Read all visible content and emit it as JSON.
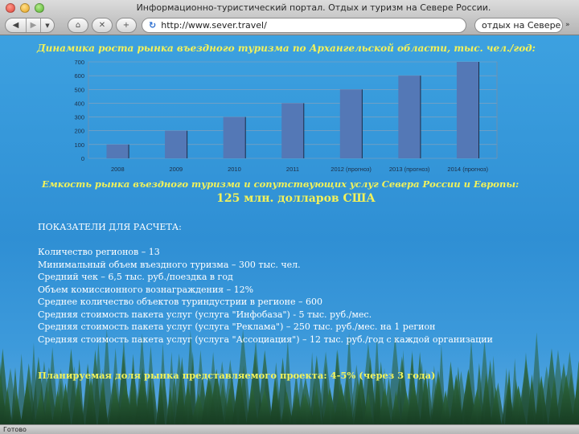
{
  "window": {
    "title": "Информационно-туристический портал. Отдых и туризм на Севере России."
  },
  "toolbar": {
    "url": "http://www.sever.travel/",
    "search_value": "отдых на Севере",
    "icons": [
      "back-icon",
      "forward-icon",
      "home-icon",
      "stop-icon",
      "add-icon",
      "reload-icon"
    ]
  },
  "chart_title": "Динамика роста рынка въездного туризма по Архангельской области, тыс. чел./год:",
  "chart_data": {
    "type": "bar",
    "categories": [
      "2008",
      "2009",
      "2010",
      "2011",
      "2012 (прогноз)",
      "2013 (прогноз)",
      "2014 (прогноз)"
    ],
    "values": [
      100,
      200,
      300,
      400,
      500,
      600,
      700
    ],
    "yticks": [
      0,
      100,
      200,
      300,
      400,
      500,
      600,
      700
    ],
    "ylim": [
      0,
      700
    ],
    "grid": true,
    "bar_color": "#5478b6"
  },
  "capacity": {
    "title": "Емкость рынка въездного туризма и сопутствующих услуг Севера России и Европы:",
    "value": "125 млн. долларов США"
  },
  "indicators": {
    "heading": "ПОКАЗАТЕЛИ ДЛЯ РАСЧЕТА:",
    "items": [
      "Количество регионов – 13",
      "Минимальный объем въездного туризма – 300 тыс. чел.",
      "Средний чек – 6,5 тыс. руб./поездка в год",
      "Объем комиссионного вознаграждения – 12%",
      "Среднее количество объектов туриндустрии в регионе – 600",
      "Средняя стоимость пакета услуг (услуга \"Инфобаза\") -  5 тыс. руб./мес.",
      "Средняя стоимость пакета услуг (услуга \"Реклама\") – 250 тыс.  руб./мес. на 1 регион",
      "Средняя стоимость пакета услуг (услуга \"Ассоциация\") – 12 тыс. руб./год  с каждой организации"
    ]
  },
  "plan": "Планируемая доля рынка представляемого проекта:  4-5% (через  3 года)",
  "status": "Готово",
  "colors": {
    "background": "#2f8fd4",
    "accent_text": "#f2f25a"
  }
}
